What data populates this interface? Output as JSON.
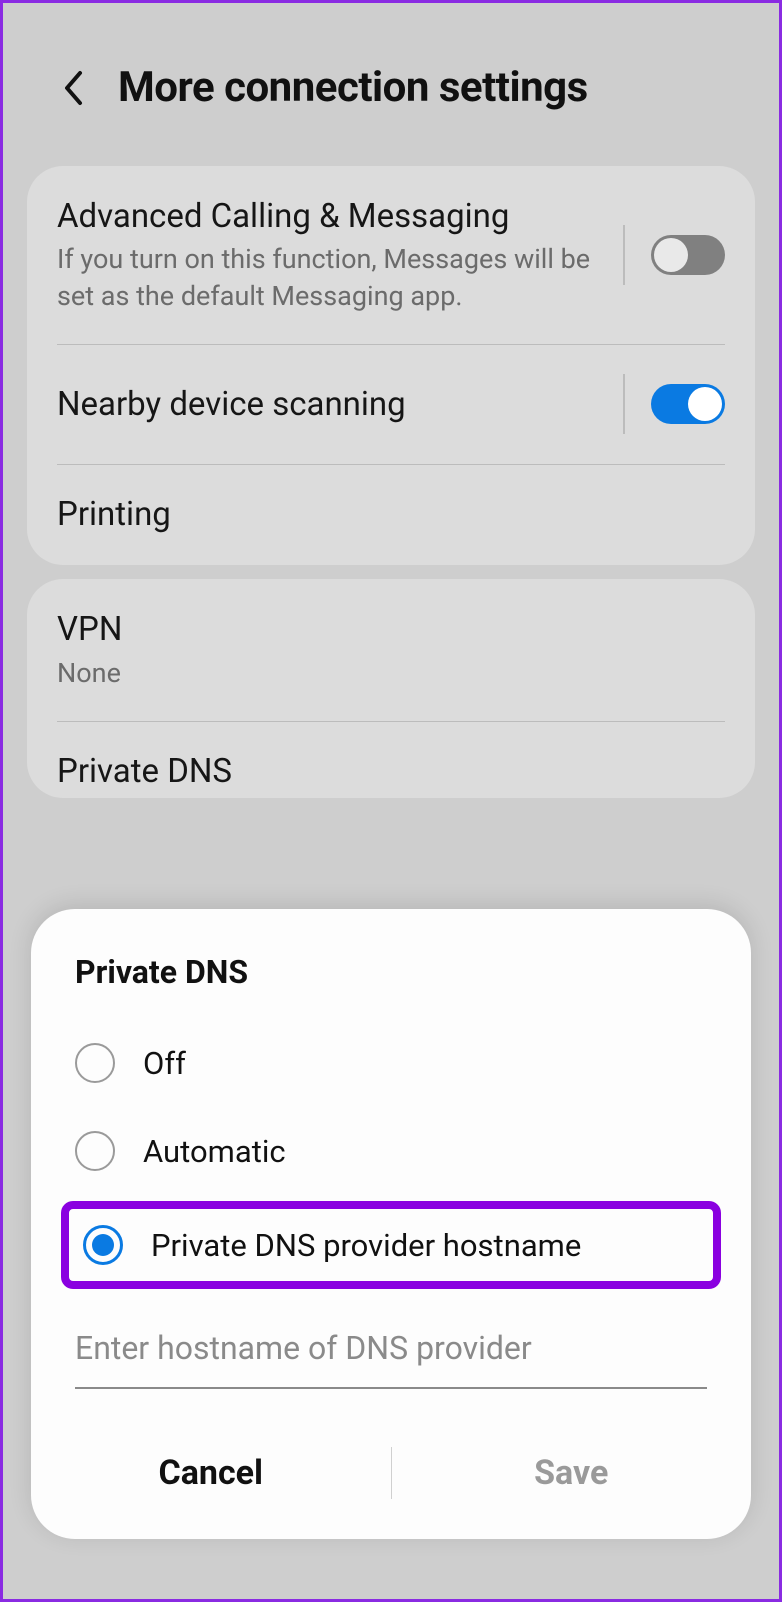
{
  "header": {
    "title": "More connection settings"
  },
  "section1": {
    "advanced": {
      "title": "Advanced Calling & Messaging",
      "subtitle": "If you turn on this function, Messages will be set as the default Messaging app.",
      "enabled": false
    },
    "nearby": {
      "title": "Nearby device scanning",
      "enabled": true
    },
    "printing": {
      "title": "Printing"
    }
  },
  "section2": {
    "vpn": {
      "title": "VPN",
      "value": "None"
    },
    "private_dns": {
      "title": "Private DNS"
    }
  },
  "dialog": {
    "title": "Private DNS",
    "options": {
      "off": "Off",
      "automatic": "Automatic",
      "provider": "Private DNS provider hostname"
    },
    "selected": "provider",
    "hostname_placeholder": "Enter hostname of DNS provider",
    "cancel": "Cancel",
    "save": "Save"
  }
}
